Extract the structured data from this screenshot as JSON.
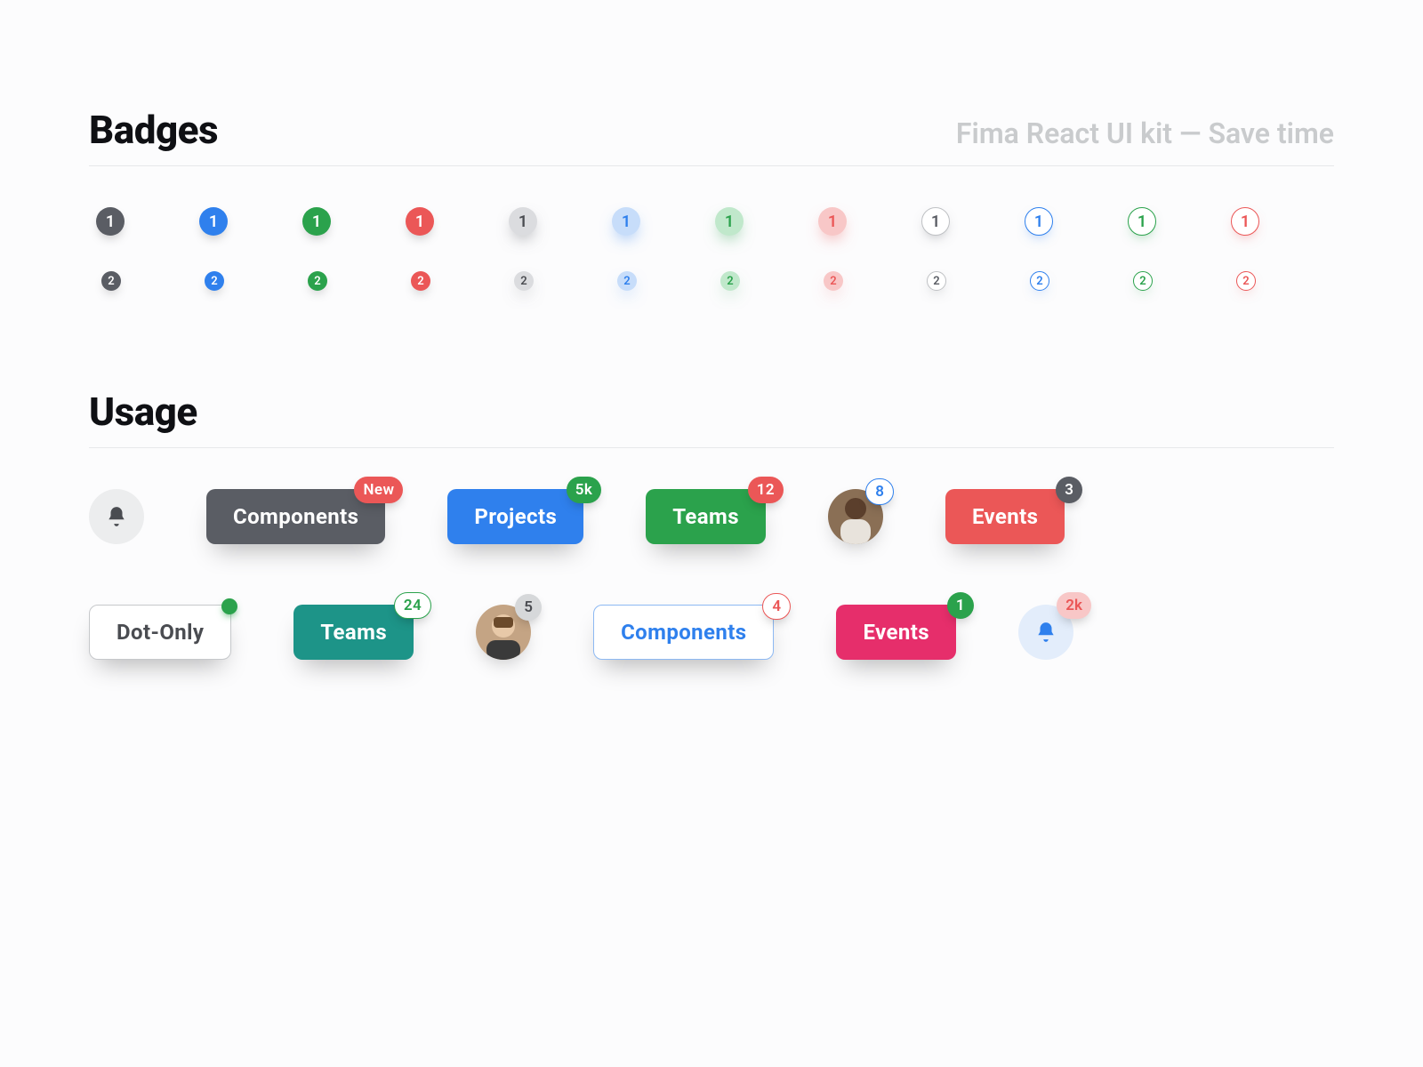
{
  "header": {
    "title": "Badges",
    "subtitle": "Fima React UI kit — Save time"
  },
  "badge_rows": [
    {
      "value": "1",
      "size": "lg"
    },
    {
      "value": "2",
      "size": "sm"
    }
  ],
  "badge_variants": [
    "fill-gray",
    "fill-blue",
    "fill-green",
    "fill-red",
    "light-gray",
    "light-blue",
    "light-green",
    "light-red",
    "outline-gray",
    "outline-blue",
    "outline-green",
    "outline-red"
  ],
  "usage": {
    "title": "Usage",
    "row1": {
      "bell": true,
      "components": {
        "label": "Components",
        "badge": "New"
      },
      "projects": {
        "label": "Projects",
        "badge": "5k"
      },
      "teams": {
        "label": "Teams",
        "badge": "12"
      },
      "avatar": {
        "badge": "8"
      },
      "events": {
        "label": "Events",
        "badge": "3"
      }
    },
    "row2": {
      "dot_only": {
        "label": "Dot-Only"
      },
      "teams": {
        "label": "Teams",
        "badge": "24"
      },
      "avatar": {
        "badge": "5"
      },
      "components": {
        "label": "Components",
        "badge": "4"
      },
      "events": {
        "label": "Events",
        "badge": "1"
      },
      "bell": {
        "badge": "2k"
      }
    }
  }
}
